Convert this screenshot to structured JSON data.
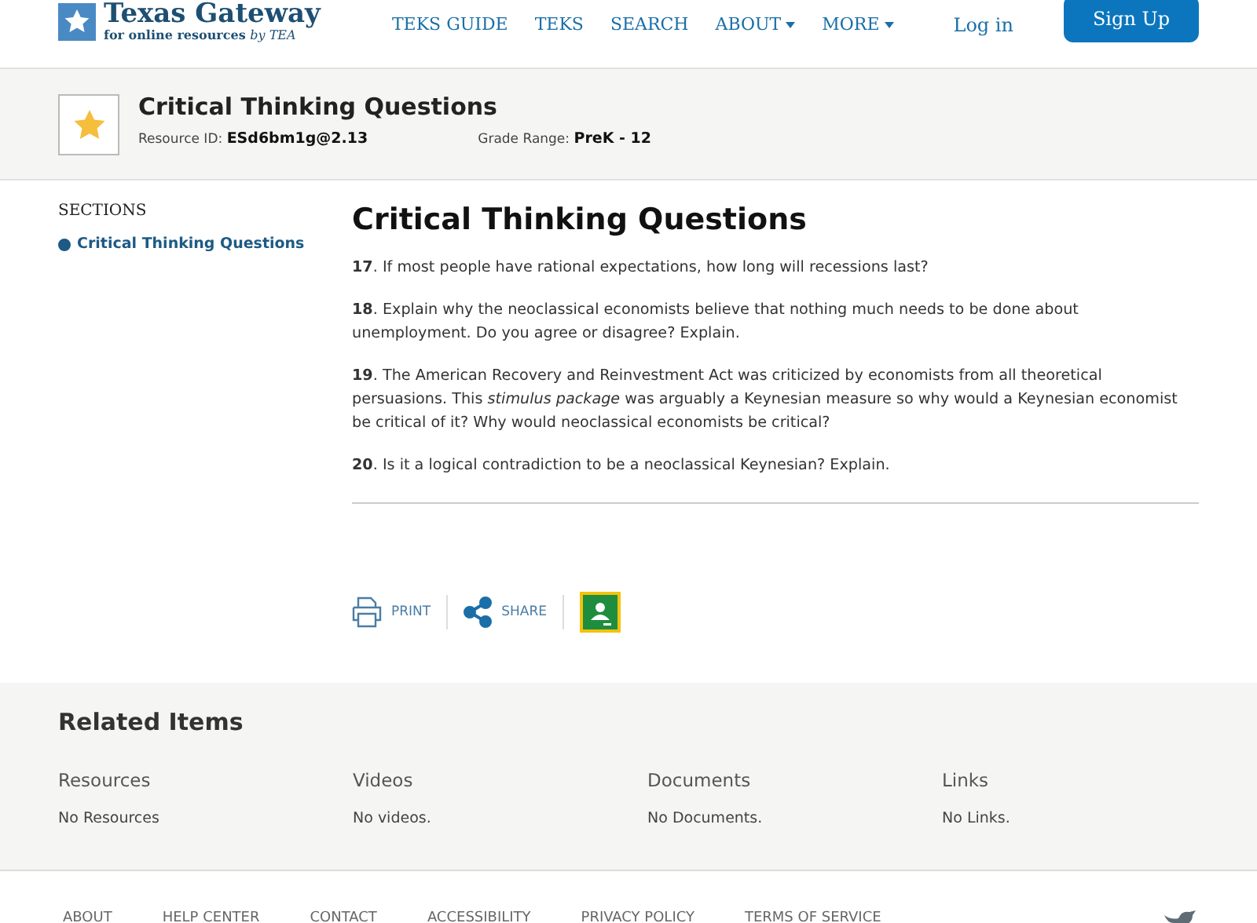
{
  "header": {
    "logo_title": "Texas Gateway",
    "logo_subtitle": "for online resources",
    "logo_by": "by TEA",
    "nav": [
      {
        "label": "TEKS GUIDE",
        "kind": "link"
      },
      {
        "label": "TEKS",
        "kind": "link"
      },
      {
        "label": "SEARCH",
        "kind": "link"
      },
      {
        "label": "ABOUT",
        "kind": "dropdown"
      },
      {
        "label": "MORE",
        "kind": "dropdown"
      }
    ],
    "login": "Log in",
    "signup": "Sign Up"
  },
  "resource": {
    "title": "Critical Thinking Questions",
    "id_label": "Resource ID:",
    "id_value": "ESd6bm1g@2.13",
    "grade_label": "Grade Range:",
    "grade_value": "PreK - 12"
  },
  "sidebar": {
    "heading": "SECTIONS",
    "items": [
      {
        "label": "Critical Thinking Questions",
        "selected": true
      }
    ]
  },
  "content": {
    "title": "Critical Thinking Questions",
    "questions": [
      "**17**. If most people have rational expectations, how long will recessions last?",
      "**18**. Explain why the neoclassical economists believe that nothing much needs to be done about unemployment. Do you agree or disagree? Explain.",
      "**19**. The American Recovery and Reinvestment Act was criticized by economists from all theoretical persuasions. This *stimulus package* was arguably a Keynesian measure so why would a Keynesian economist be critical of it? Why would neoclassical economists be critical?",
      "**20**. Is it a logical contradiction to be a neoclassical Keynesian? Explain."
    ],
    "actions": [
      {
        "kind": "print",
        "label": "PRINT"
      },
      {
        "kind": "share",
        "label": "SHARE"
      },
      {
        "kind": "classroom"
      }
    ]
  },
  "related": {
    "title": "Related Items",
    "columns": [
      {
        "heading": "Resources",
        "text": "No Resources"
      },
      {
        "heading": "Videos",
        "text": "No videos."
      },
      {
        "heading": "Documents",
        "text": "No Documents."
      },
      {
        "heading": "Links",
        "text": "No Links."
      }
    ]
  },
  "footer": {
    "links": [
      "ABOUT",
      "HELP CENTER",
      "CONTACT",
      "ACCESSIBILITY",
      "PRIVACY POLICY",
      "TERMS OF SERVICE"
    ]
  }
}
